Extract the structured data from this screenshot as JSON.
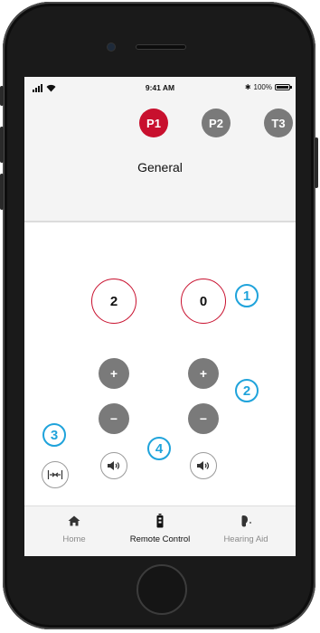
{
  "status_bar": {
    "time": "9:41 AM",
    "battery_text": "100%"
  },
  "programs": [
    {
      "label": "P1",
      "active": true,
      "color": "#c8102e"
    },
    {
      "label": "P2",
      "active": false,
      "color": "#7a7a7a"
    },
    {
      "label": "T3",
      "active": false,
      "color": "#7a7a7a"
    }
  ],
  "program_title": "General",
  "volume": {
    "left": "2",
    "right": "0"
  },
  "controls": {
    "plus_symbol": "+",
    "minus_symbol": "−"
  },
  "callouts": [
    "1",
    "2",
    "3",
    "4"
  ],
  "tabs": [
    {
      "label": "Home",
      "icon": "home-icon",
      "active": false
    },
    {
      "label": "Remote Control",
      "icon": "remote-control-icon",
      "active": true
    },
    {
      "label": "Hearing Aid",
      "icon": "hearing-aid-icon",
      "active": false
    }
  ],
  "colors": {
    "accent": "#c8102e",
    "callout": "#1fa3db",
    "button_gray": "#7a7a7a"
  }
}
